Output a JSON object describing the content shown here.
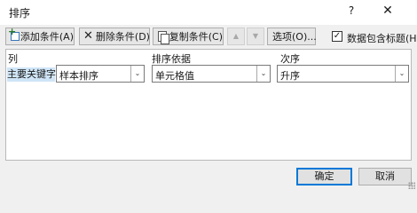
{
  "window": {
    "title": "排序",
    "help": "?",
    "close": "✕"
  },
  "toolbar": {
    "add_label": "添加条件(A)",
    "delete_label": "删除条件(D)",
    "copy_label": "复制条件(C)",
    "move_up": "▲",
    "move_down": "▼",
    "options_label": "选项(O)...",
    "header_checkbox_checked": true,
    "header_checkbox_mark": "✓",
    "header_checkbox_label": "数据包含标题(H)"
  },
  "grid": {
    "headers": {
      "column": "列",
      "sort_on": "排序依据",
      "order": "次序"
    },
    "rows": [
      {
        "label": "主要关键字",
        "column": "样本排序",
        "sort_on": "单元格值",
        "order": "升序"
      }
    ]
  },
  "dropdown_glyph": "⌄",
  "buttons": {
    "ok": "确定",
    "cancel": "取消"
  },
  "colors": {
    "selected_row": "#cfe5f7",
    "primary_border": "#0078d7"
  }
}
